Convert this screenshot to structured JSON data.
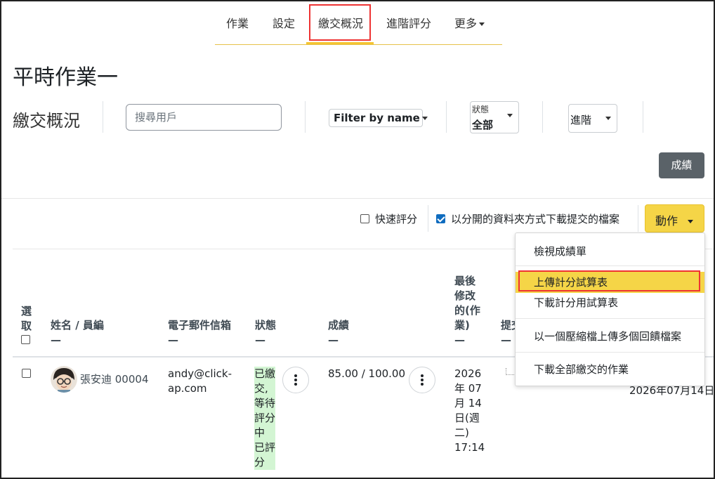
{
  "nav": {
    "items": [
      "作業",
      "設定",
      "繳交概況",
      "進階評分",
      "更多"
    ],
    "active": "繳交概況"
  },
  "page_title": "平時作業一",
  "section_title": "繳交概況",
  "search": {
    "placeholder": "搜尋用戶"
  },
  "filter": {
    "label": "Filter by name"
  },
  "status_select": {
    "label": "狀態",
    "value": "全部"
  },
  "advanced_select": {
    "value": "進階"
  },
  "grade_button": "成績",
  "options": {
    "quick_grading": "快速評分",
    "download_folders": "以分開的資料夾方式下載提交的檔案"
  },
  "action_button": "動作",
  "action_menu": {
    "items": [
      "檢視成績單",
      "上傳計分試算表",
      "下載計分用試算表",
      "以一個壓縮檔上傳多個回饋檔案",
      "下載全部繳交的作業"
    ],
    "highlighted": "上傳計分試算表"
  },
  "table": {
    "headers": {
      "select_line1": "選",
      "select_line2": "取",
      "name": "姓名 / 員編",
      "email": "電子郵件信箱",
      "status": "狀態",
      "grade": "成績",
      "modified_l1": "最後",
      "modified_l2": "修改",
      "modified_l3": "的(作",
      "modified_l4": "業)",
      "submission": "提交",
      "dash": "—"
    },
    "rows": [
      {
        "name": "張安迪 00004",
        "email_l1": "andy@click-",
        "email_l2": "ap.com",
        "status_lines": [
          "已繳",
          "交,",
          "等待",
          "評分",
          "中",
          "已評",
          "分"
        ],
        "grade": "85.00 / 100.00",
        "modified_lines": [
          "2026",
          "年 07",
          "月 14",
          "日(週",
          "二)",
          "17:14"
        ],
        "extra_date": "2026年07月14日"
      }
    ]
  },
  "colors": {
    "accent": "#f5d547",
    "highlight_border": "#e33333",
    "grade_button": "#5a6268",
    "status_bg": "#d3f5d3"
  }
}
